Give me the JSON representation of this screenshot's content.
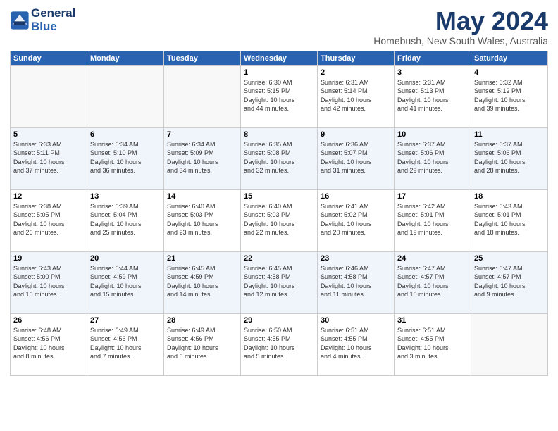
{
  "header": {
    "logo_line1": "General",
    "logo_line2": "Blue",
    "month": "May 2024",
    "location": "Homebush, New South Wales, Australia"
  },
  "weekdays": [
    "Sunday",
    "Monday",
    "Tuesday",
    "Wednesday",
    "Thursday",
    "Friday",
    "Saturday"
  ],
  "weeks": [
    [
      {
        "day": "",
        "info": ""
      },
      {
        "day": "",
        "info": ""
      },
      {
        "day": "",
        "info": ""
      },
      {
        "day": "1",
        "info": "Sunrise: 6:30 AM\nSunset: 5:15 PM\nDaylight: 10 hours\nand 44 minutes."
      },
      {
        "day": "2",
        "info": "Sunrise: 6:31 AM\nSunset: 5:14 PM\nDaylight: 10 hours\nand 42 minutes."
      },
      {
        "day": "3",
        "info": "Sunrise: 6:31 AM\nSunset: 5:13 PM\nDaylight: 10 hours\nand 41 minutes."
      },
      {
        "day": "4",
        "info": "Sunrise: 6:32 AM\nSunset: 5:12 PM\nDaylight: 10 hours\nand 39 minutes."
      }
    ],
    [
      {
        "day": "5",
        "info": "Sunrise: 6:33 AM\nSunset: 5:11 PM\nDaylight: 10 hours\nand 37 minutes."
      },
      {
        "day": "6",
        "info": "Sunrise: 6:34 AM\nSunset: 5:10 PM\nDaylight: 10 hours\nand 36 minutes."
      },
      {
        "day": "7",
        "info": "Sunrise: 6:34 AM\nSunset: 5:09 PM\nDaylight: 10 hours\nand 34 minutes."
      },
      {
        "day": "8",
        "info": "Sunrise: 6:35 AM\nSunset: 5:08 PM\nDaylight: 10 hours\nand 32 minutes."
      },
      {
        "day": "9",
        "info": "Sunrise: 6:36 AM\nSunset: 5:07 PM\nDaylight: 10 hours\nand 31 minutes."
      },
      {
        "day": "10",
        "info": "Sunrise: 6:37 AM\nSunset: 5:06 PM\nDaylight: 10 hours\nand 29 minutes."
      },
      {
        "day": "11",
        "info": "Sunrise: 6:37 AM\nSunset: 5:06 PM\nDaylight: 10 hours\nand 28 minutes."
      }
    ],
    [
      {
        "day": "12",
        "info": "Sunrise: 6:38 AM\nSunset: 5:05 PM\nDaylight: 10 hours\nand 26 minutes."
      },
      {
        "day": "13",
        "info": "Sunrise: 6:39 AM\nSunset: 5:04 PM\nDaylight: 10 hours\nand 25 minutes."
      },
      {
        "day": "14",
        "info": "Sunrise: 6:40 AM\nSunset: 5:03 PM\nDaylight: 10 hours\nand 23 minutes."
      },
      {
        "day": "15",
        "info": "Sunrise: 6:40 AM\nSunset: 5:03 PM\nDaylight: 10 hours\nand 22 minutes."
      },
      {
        "day": "16",
        "info": "Sunrise: 6:41 AM\nSunset: 5:02 PM\nDaylight: 10 hours\nand 20 minutes."
      },
      {
        "day": "17",
        "info": "Sunrise: 6:42 AM\nSunset: 5:01 PM\nDaylight: 10 hours\nand 19 minutes."
      },
      {
        "day": "18",
        "info": "Sunrise: 6:43 AM\nSunset: 5:01 PM\nDaylight: 10 hours\nand 18 minutes."
      }
    ],
    [
      {
        "day": "19",
        "info": "Sunrise: 6:43 AM\nSunset: 5:00 PM\nDaylight: 10 hours\nand 16 minutes."
      },
      {
        "day": "20",
        "info": "Sunrise: 6:44 AM\nSunset: 4:59 PM\nDaylight: 10 hours\nand 15 minutes."
      },
      {
        "day": "21",
        "info": "Sunrise: 6:45 AM\nSunset: 4:59 PM\nDaylight: 10 hours\nand 14 minutes."
      },
      {
        "day": "22",
        "info": "Sunrise: 6:45 AM\nSunset: 4:58 PM\nDaylight: 10 hours\nand 12 minutes."
      },
      {
        "day": "23",
        "info": "Sunrise: 6:46 AM\nSunset: 4:58 PM\nDaylight: 10 hours\nand 11 minutes."
      },
      {
        "day": "24",
        "info": "Sunrise: 6:47 AM\nSunset: 4:57 PM\nDaylight: 10 hours\nand 10 minutes."
      },
      {
        "day": "25",
        "info": "Sunrise: 6:47 AM\nSunset: 4:57 PM\nDaylight: 10 hours\nand 9 minutes."
      }
    ],
    [
      {
        "day": "26",
        "info": "Sunrise: 6:48 AM\nSunset: 4:56 PM\nDaylight: 10 hours\nand 8 minutes."
      },
      {
        "day": "27",
        "info": "Sunrise: 6:49 AM\nSunset: 4:56 PM\nDaylight: 10 hours\nand 7 minutes."
      },
      {
        "day": "28",
        "info": "Sunrise: 6:49 AM\nSunset: 4:56 PM\nDaylight: 10 hours\nand 6 minutes."
      },
      {
        "day": "29",
        "info": "Sunrise: 6:50 AM\nSunset: 4:55 PM\nDaylight: 10 hours\nand 5 minutes."
      },
      {
        "day": "30",
        "info": "Sunrise: 6:51 AM\nSunset: 4:55 PM\nDaylight: 10 hours\nand 4 minutes."
      },
      {
        "day": "31",
        "info": "Sunrise: 6:51 AM\nSunset: 4:55 PM\nDaylight: 10 hours\nand 3 minutes."
      },
      {
        "day": "",
        "info": ""
      }
    ]
  ]
}
